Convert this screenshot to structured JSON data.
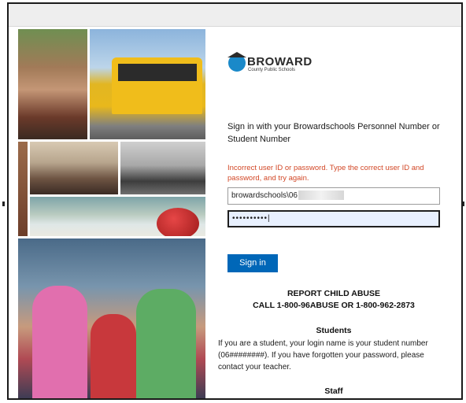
{
  "logo": {
    "wordmark": "BROWARD",
    "subtitle": "County Public Schools"
  },
  "signin": {
    "prompt": "Sign in with your Browardschools Personnel Number or Student Number",
    "error": "Incorrect user ID or password. Type the correct user ID and password, and try again.",
    "username_value": "browardschools\\06",
    "password_mask": "••••••••••|",
    "button_label": "Sign in"
  },
  "notices": {
    "abuse_title": "REPORT CHILD ABUSE",
    "abuse_phone": "CALL 1-800-96ABUSE OR 1-800-962-2873"
  },
  "students": {
    "heading": "Students",
    "text": "If you are a student, your login name is your student number (06########). If you have forgotten your password, please contact your teacher."
  },
  "staff": {
    "heading": "Staff"
  },
  "colors": {
    "button": "#0067b8",
    "error": "#d24726",
    "logo_icon": "#1a89c9"
  }
}
